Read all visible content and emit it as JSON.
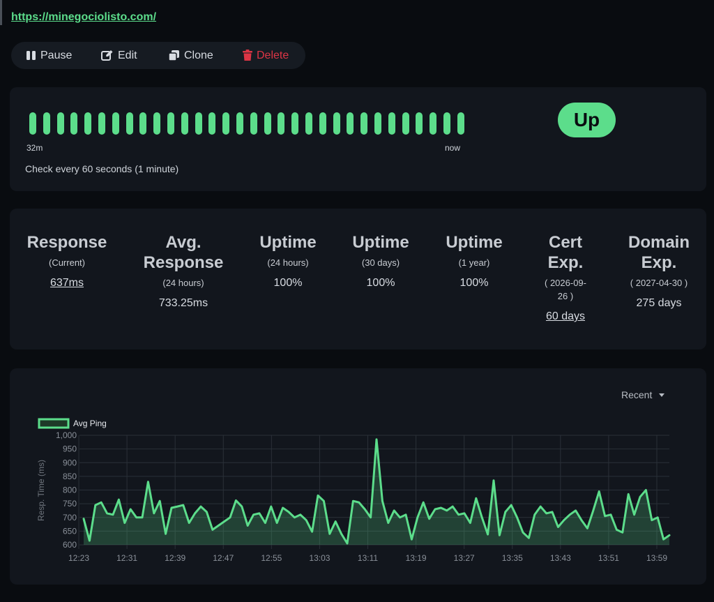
{
  "url": "https://minegociolisto.com/",
  "toolbar": {
    "pause": "Pause",
    "edit": "Edit",
    "clone": "Clone",
    "delete": "Delete"
  },
  "heartbeat": {
    "count": 32,
    "color": "#5cdd8b",
    "start_label": "32m",
    "end_label": "now",
    "interval_text": "Check every 60 seconds (1 minute)",
    "status": "Up"
  },
  "stats": {
    "response": {
      "title": "Response",
      "sub": "(Current)",
      "value": "637ms"
    },
    "avg_response": {
      "title_line1": "Avg.",
      "title_line2": "Response",
      "sub": "(24 hours)",
      "value": "733.25ms"
    },
    "uptime_24h": {
      "title": "Uptime",
      "sub": "(24 hours)",
      "value": "100%"
    },
    "uptime_30d": {
      "title": "Uptime",
      "sub": "(30 days)",
      "value": "100%"
    },
    "uptime_1y": {
      "title": "Uptime",
      "sub": "(1 year)",
      "value": "100%"
    },
    "cert_exp": {
      "title_line1": "Cert",
      "title_line2": "Exp.",
      "sub_line1": "( 2026-09-",
      "sub_line2": "26 )",
      "value": "60 days"
    },
    "domain_exp": {
      "title_line1": "Domain",
      "title_line2": "Exp.",
      "sub": "( 2027-04-30 )",
      "value": "275 days"
    }
  },
  "range_select": "Recent",
  "chart_data": {
    "type": "area",
    "legend": "Avg Ping",
    "ylabel": "Resp. Time (ms)",
    "ylim": [
      600,
      1000
    ],
    "yticks": [
      600,
      650,
      700,
      750,
      800,
      850,
      900,
      950,
      1000
    ],
    "ytick_labels": [
      "600",
      "650",
      "700",
      "750",
      "800",
      "850",
      "900",
      "950",
      "1,000"
    ],
    "xticks": [
      "12:23",
      "12:31",
      "12:39",
      "12:47",
      "12:55",
      "13:03",
      "13:11",
      "13:19",
      "13:27",
      "13:35",
      "13:43",
      "13:51",
      "13:59"
    ],
    "grid": true,
    "line_color": "#5cdd8b",
    "values": [
      695,
      615,
      745,
      755,
      715,
      710,
      765,
      680,
      730,
      700,
      700,
      830,
      715,
      760,
      640,
      735,
      740,
      745,
      680,
      715,
      740,
      720,
      655,
      670,
      685,
      700,
      762,
      740,
      670,
      710,
      715,
      680,
      740,
      680,
      735,
      720,
      700,
      710,
      690,
      648,
      780,
      760,
      640,
      685,
      640,
      605,
      760,
      755,
      730,
      700,
      985,
      760,
      680,
      725,
      700,
      710,
      620,
      700,
      755,
      695,
      730,
      735,
      725,
      740,
      710,
      715,
      680,
      770,
      700,
      638,
      835,
      635,
      720,
      745,
      700,
      645,
      625,
      710,
      740,
      715,
      720,
      665,
      690,
      710,
      725,
      690,
      660,
      725,
      795,
      705,
      710,
      655,
      645,
      785,
      710,
      775,
      800,
      690,
      700,
      620,
      635
    ]
  }
}
